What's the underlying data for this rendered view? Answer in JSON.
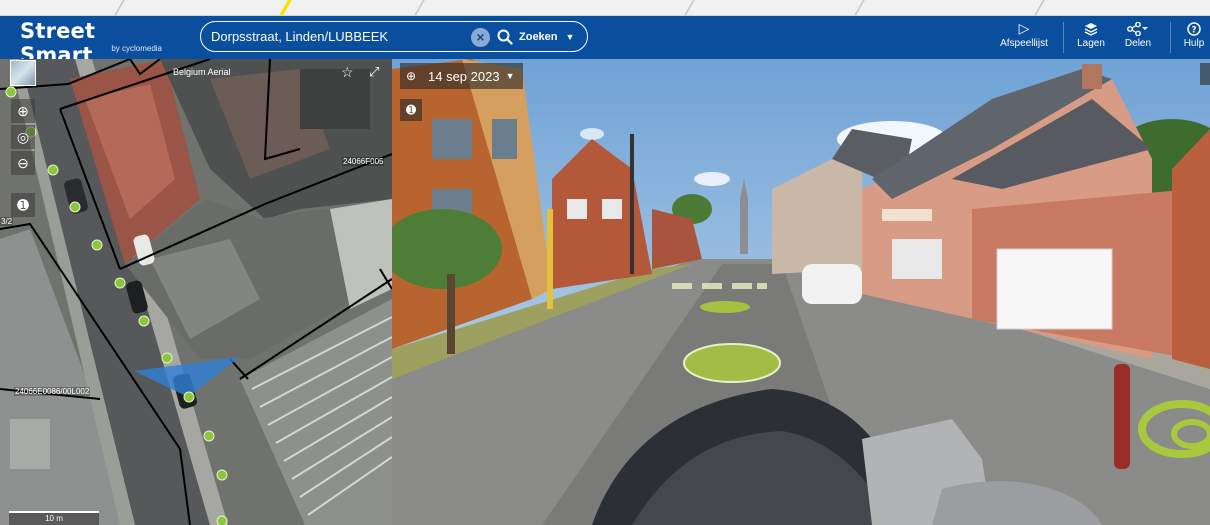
{
  "header": {
    "logo_title": "Street Smart",
    "logo_sub": "by cyclomedia",
    "search_value": "Dorpsstraat, Linden/LUBBEEK",
    "search_button_label": "Zoeken",
    "buttons": [
      {
        "name": "playlist",
        "label": "Afspeellijst",
        "icon": "play-icon"
      },
      {
        "name": "layers",
        "label": "Lagen",
        "icon": "layers-icon"
      },
      {
        "name": "share",
        "label": "Delen",
        "icon": "share-icon"
      },
      {
        "name": "help",
        "label": "Hulp",
        "icon": "help-icon"
      }
    ]
  },
  "map": {
    "layer_label": "Belgium Aerial",
    "parcel_code_1": "24066F005",
    "parcel_code_2": "24066E0086/00L002",
    "edge_code": "3/2",
    "scale_label": "10 m",
    "controls": [
      "zoom-in-icon",
      "locate-icon",
      "zoom-out-icon",
      "north-icon"
    ]
  },
  "panorama": {
    "date": "14 sep 2023",
    "accent": "#a8c93c"
  },
  "colors": {
    "brand": "#0a4e9e",
    "recording_point": "#8cc63f",
    "view_cone": "#2f7fd6"
  }
}
